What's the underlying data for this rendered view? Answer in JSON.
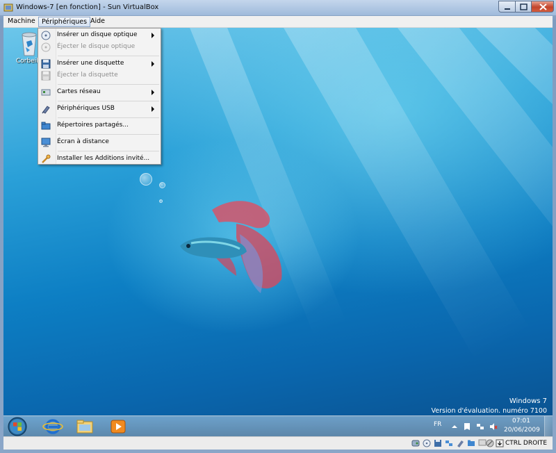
{
  "window": {
    "title": "Windows-7 [en fonction] - Sun VirtualBox"
  },
  "menubar": {
    "items": [
      {
        "label": "Machine"
      },
      {
        "label": "Périphériques"
      },
      {
        "label": "Aide"
      }
    ]
  },
  "dropdown": {
    "items": [
      {
        "label": "Insérer un disque optique",
        "icon": "optical-disc-icon",
        "disabled": false,
        "submenu": true
      },
      {
        "label": "Éjecter le disque optique",
        "icon": "optical-disc-eject-icon",
        "disabled": true,
        "submenu": false
      },
      {
        "label": "Insérer une disquette",
        "icon": "floppy-icon",
        "disabled": false,
        "submenu": true
      },
      {
        "label": "Éjecter la disquette",
        "icon": "floppy-eject-icon",
        "disabled": true,
        "submenu": false
      },
      {
        "label": "Cartes réseau",
        "icon": "network-card-icon",
        "disabled": false,
        "submenu": true
      },
      {
        "label": "Périphériques USB",
        "icon": "usb-icon",
        "disabled": false,
        "submenu": true
      },
      {
        "label": "Répertoires partagés...",
        "icon": "shared-folder-icon",
        "disabled": false,
        "submenu": false
      },
      {
        "label": "Écran à distance",
        "icon": "remote-display-icon",
        "disabled": false,
        "submenu": false
      },
      {
        "label": "Installer les Additions invité...",
        "icon": "guest-additions-icon",
        "disabled": false,
        "submenu": false
      }
    ]
  },
  "desktop": {
    "recycle_bin_label": "Corbeille",
    "watermark": {
      "line1": "Windows 7",
      "line2": "Version d'évaluation. numéro 7100"
    }
  },
  "taskbar": {
    "language": "FR",
    "clock_time": "07:01",
    "clock_date": "20/06/2009",
    "apps": [
      "start-orb-icon",
      "internet-explorer-icon",
      "windows-explorer-icon",
      "media-player-icon"
    ]
  },
  "statusbar": {
    "host_key": "CTRL DROITE"
  },
  "colors": {
    "desktop_top": "#6cc6ea",
    "desktop_bottom": "#0a4f8c",
    "menu_background": "#f3f3f3",
    "disabled_text": "#8d8d8d",
    "close_button": "#c1442b"
  }
}
